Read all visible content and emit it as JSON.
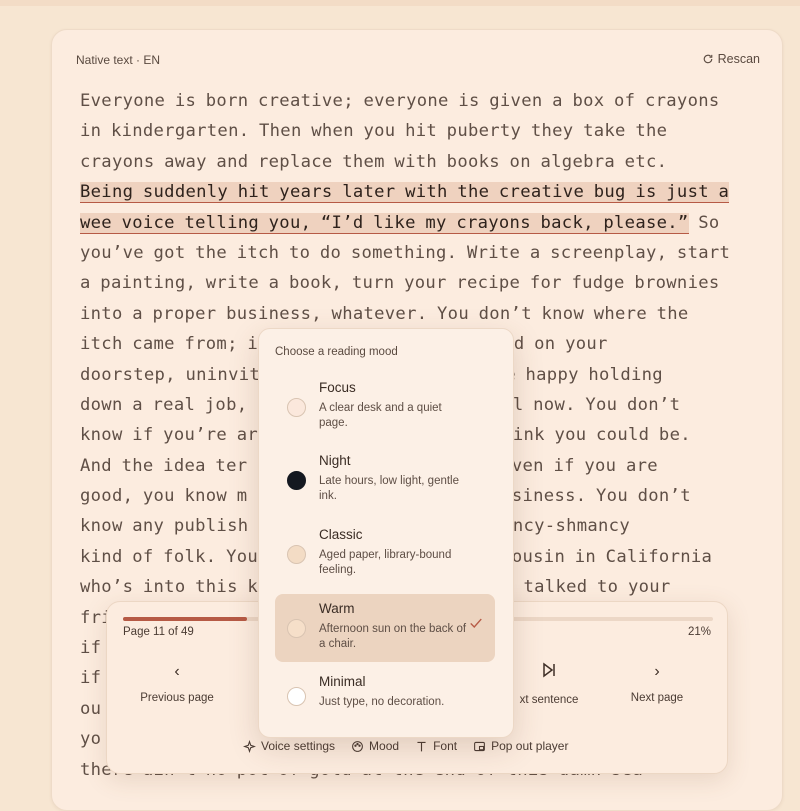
{
  "source_label": "Native text · EN",
  "rescan_label": "Rescan",
  "text_lines": [
    {
      "pre": "Everyone is born creative; everyone is given a box of crayons",
      "hl": "",
      "post": ""
    },
    {
      "pre": "in kindergarten. Then when you hit puberty they take the",
      "hl": "",
      "post": ""
    },
    {
      "pre": "crayons away and replace them with books on algebra etc.",
      "hl": "",
      "post": ""
    },
    {
      "pre": "",
      "hl": "Being suddenly hit years later with the creative bug is just a",
      "post": ""
    },
    {
      "pre": "",
      "hl": "wee voice telling you, “I’d like my crayons back, please.”",
      "post": " So"
    },
    {
      "pre": "you’ve got the itch to do something. Write a screenplay, start",
      "hl": "",
      "post": ""
    },
    {
      "pre": "a painting, write a book, turn your recipe for fudge brownies",
      "hl": "",
      "post": ""
    },
    {
      "pre": "into a proper business, whatever. You don’t know where the",
      "hl": "",
      "post": ""
    },
    {
      "pre": "itch came from; i                     rrived on your",
      "hl": "",
      "post": ""
    },
    {
      "pre": "doorstep, uninvit                     quite happy holding",
      "hl": "",
      "post": ""
    },
    {
      "pre": "down a real job,                      .Until now. You don’t",
      "hl": "",
      "post": ""
    },
    {
      "pre": "know if you’re ar                     ’d think you could be.",
      "hl": "",
      "post": ""
    },
    {
      "pre": "And the idea ter                      is, even if you are",
      "hl": "",
      "post": ""
    },
    {
      "pre": "good, you know m                      of business. You don’t",
      "hl": "",
      "post": ""
    },
    {
      "pre": "know any publish                      se fancy-shmancy",
      "hl": "",
      "post": ""
    },
    {
      "pre": "kind of folk. You                     t a cousin in California",
      "hl": "",
      "post": ""
    },
    {
      "pre": "who’s into this k                     ven’t talked to your",
      "hl": "",
      "post": ""
    },
    {
      "pre": "fri                                                       at",
      "hl": "",
      "post": ""
    },
    {
      "pre": "if",
      "hl": "",
      "post": ""
    },
    {
      "pre": "if",
      "hl": "",
      "post": ""
    },
    {
      "pre": "ou                                                        e;",
      "hl": "",
      "post": ""
    },
    {
      "pre": "yo                                                        if",
      "hl": "",
      "post": ""
    },
    {
      "pre": "there ain’t no pot of gold at the end of this damn sea",
      "hl": "",
      "post": ""
    }
  ],
  "player": {
    "page_label": "Page 11 of 49",
    "percent_label": "21%",
    "progress_fraction": 0.21,
    "prev_label": "Previous page",
    "next_sentence_label": "xt sentence",
    "next_label": "Next page",
    "voice_settings": "Voice settings",
    "mood": "Mood",
    "font": "Font",
    "pop_out": "Pop out player"
  },
  "mood_popover": {
    "title": "Choose a reading mood",
    "options": [
      {
        "name": "Focus",
        "desc": "A clear desk and a quiet page.",
        "swatch": "#fbe8dc",
        "selected": false
      },
      {
        "name": "Night",
        "desc": "Late hours, low light, gentle ink.",
        "swatch": "#141820",
        "selected": false
      },
      {
        "name": "Classic",
        "desc": "Aged paper, library-bound feeling.",
        "swatch": "#f3dcc5",
        "selected": false
      },
      {
        "name": "Warm",
        "desc": "Afternoon sun on the back of a chair.",
        "swatch": "#f6dfc9",
        "selected": true
      },
      {
        "name": "Minimal",
        "desc": "Just type, no decoration.",
        "swatch": "#ffffff",
        "selected": false
      }
    ]
  },
  "colors": {
    "accent": "#b65a45",
    "background": "#f7e6d2",
    "card": "#fcecdf"
  }
}
